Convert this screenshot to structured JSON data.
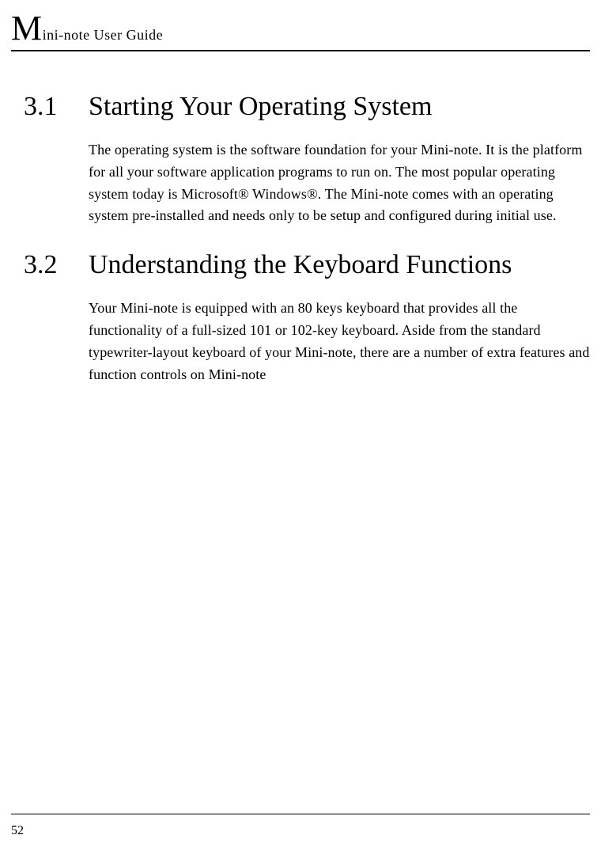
{
  "header": {
    "title_first_char": "M",
    "title_rest": "ini-note User Guide"
  },
  "sections": [
    {
      "number": "3.1",
      "title": "Starting Your Operating System",
      "body": "The operating system is the software foundation for your Mini-note. It is the platform for all your software application programs to run on.  The most popular operating system today is Microsoft® Windows®. The Mini-note comes with an operating system pre-installed and needs only to be setup and configured during initial use."
    },
    {
      "number": "3.2",
      "title": "Understanding the Keyboard Functions",
      "body": "Your Mini-note is equipped with an 80 keys keyboard that provides all the functionality of a full-sized 101 or 102-key keyboard. Aside from the standard typewriter-layout keyboard of your Mini-note, there are a number of extra features and function controls on Mini-note"
    }
  ],
  "page_number": "52"
}
